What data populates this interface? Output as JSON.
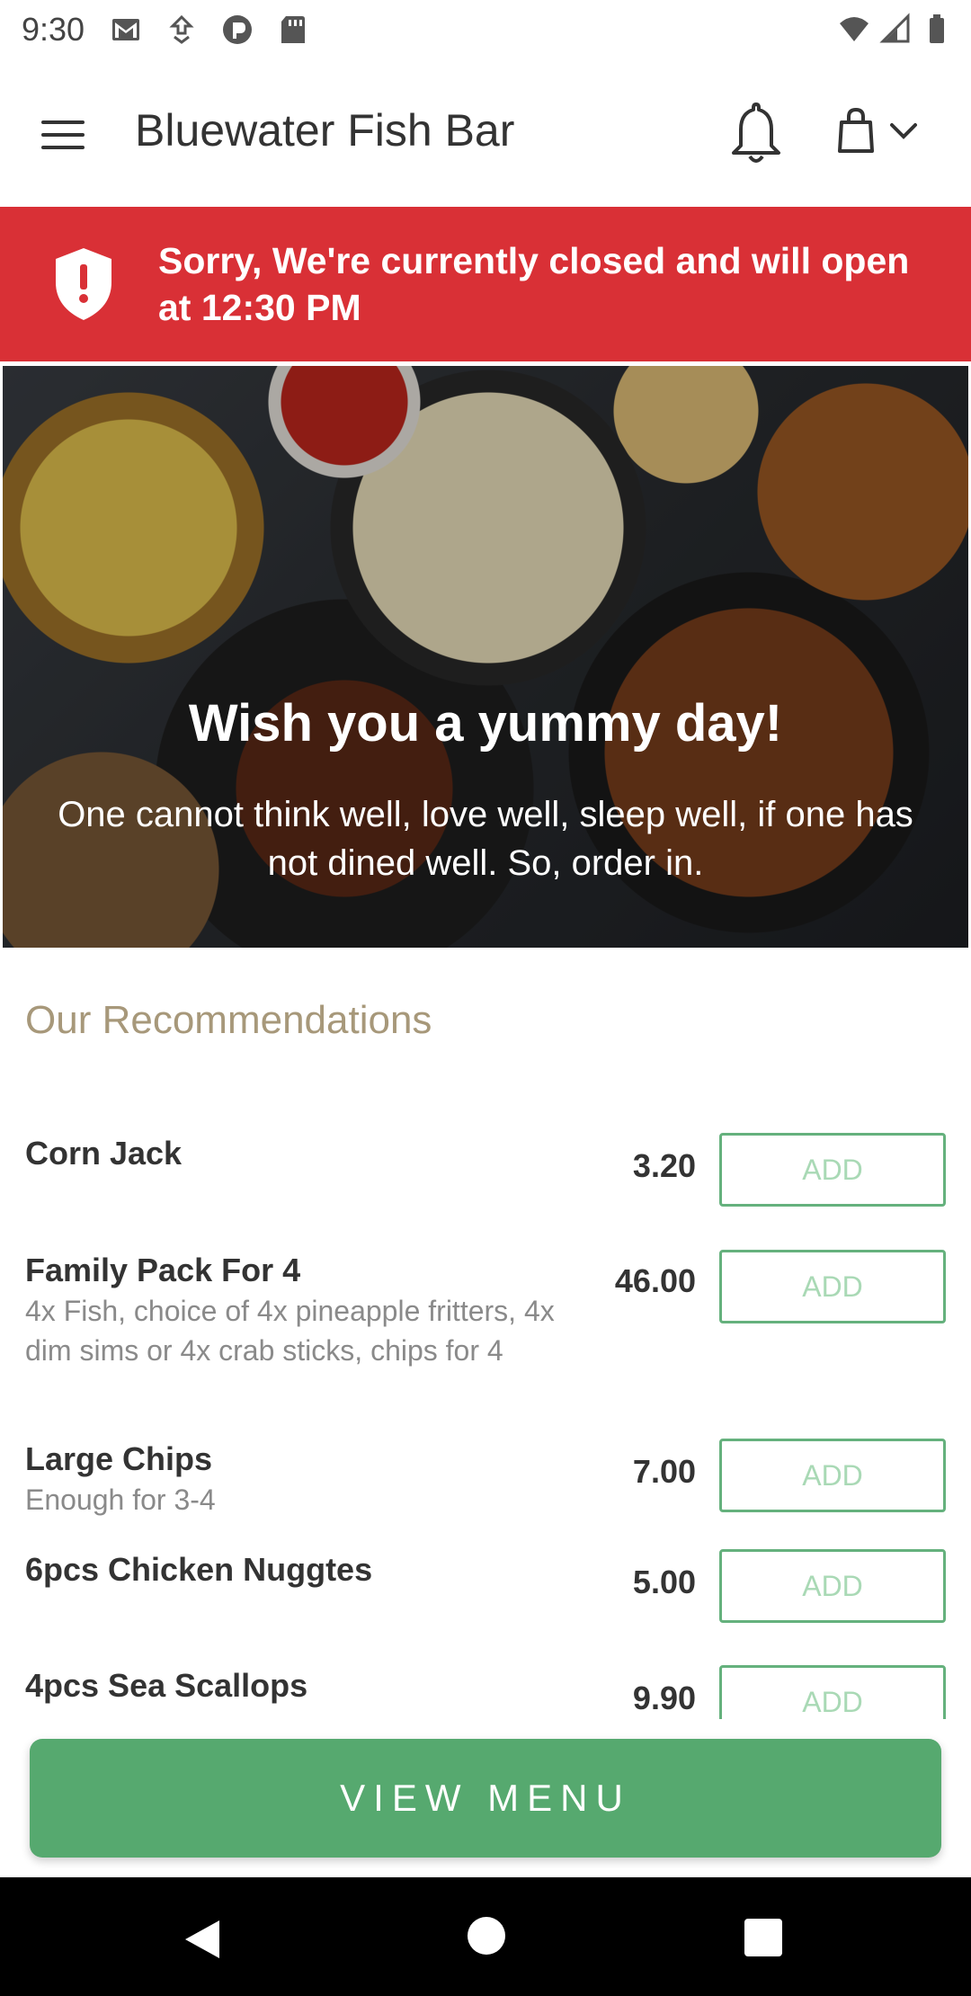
{
  "status_bar": {
    "time": "9:30",
    "left_icons": [
      "gmail-icon",
      "download-icon",
      "pocket-icon",
      "sd-card-icon"
    ],
    "right_icons": [
      "wifi-icon",
      "signal-icon",
      "battery-icon"
    ]
  },
  "app_bar": {
    "title": "Bluewater Fish Bar",
    "icons": [
      "menu-icon",
      "bell-icon",
      "shopping-bag-icon",
      "chevron-down-icon"
    ]
  },
  "closed_banner": {
    "text": "Sorry, We're currently closed and will open at 12:30 PM",
    "color": "#d93036",
    "icon": "shield-alert-icon"
  },
  "hero": {
    "title": "Wish you a yummy day!",
    "subtitle": "One cannot think well, love well, sleep well, if one has not dined well. So, order in."
  },
  "recommendations": {
    "heading": "Our Recommendations",
    "add_label": "ADD",
    "items": [
      {
        "name": "Corn Jack",
        "description": "",
        "price": "3.20"
      },
      {
        "name": "Family Pack For 4",
        "description": "4x Fish, choice of 4x pineapple fritters, 4x dim sims or 4x crab sticks, chips for 4",
        "price": "46.00"
      },
      {
        "name": "Large Chips",
        "description": "Enough for 3-4",
        "price": "7.00"
      },
      {
        "name": "6pcs Chicken Nuggtes",
        "description": "",
        "price": "5.00"
      },
      {
        "name": "4pcs Sea Scallops",
        "description": "",
        "price": "9.90"
      }
    ]
  },
  "view_menu": {
    "label": "VIEW MENU",
    "color": "#56a96f"
  },
  "colors": {
    "accent_green": "#56a96f",
    "banner_red": "#d93036",
    "heading_tan": "#a7987a"
  }
}
